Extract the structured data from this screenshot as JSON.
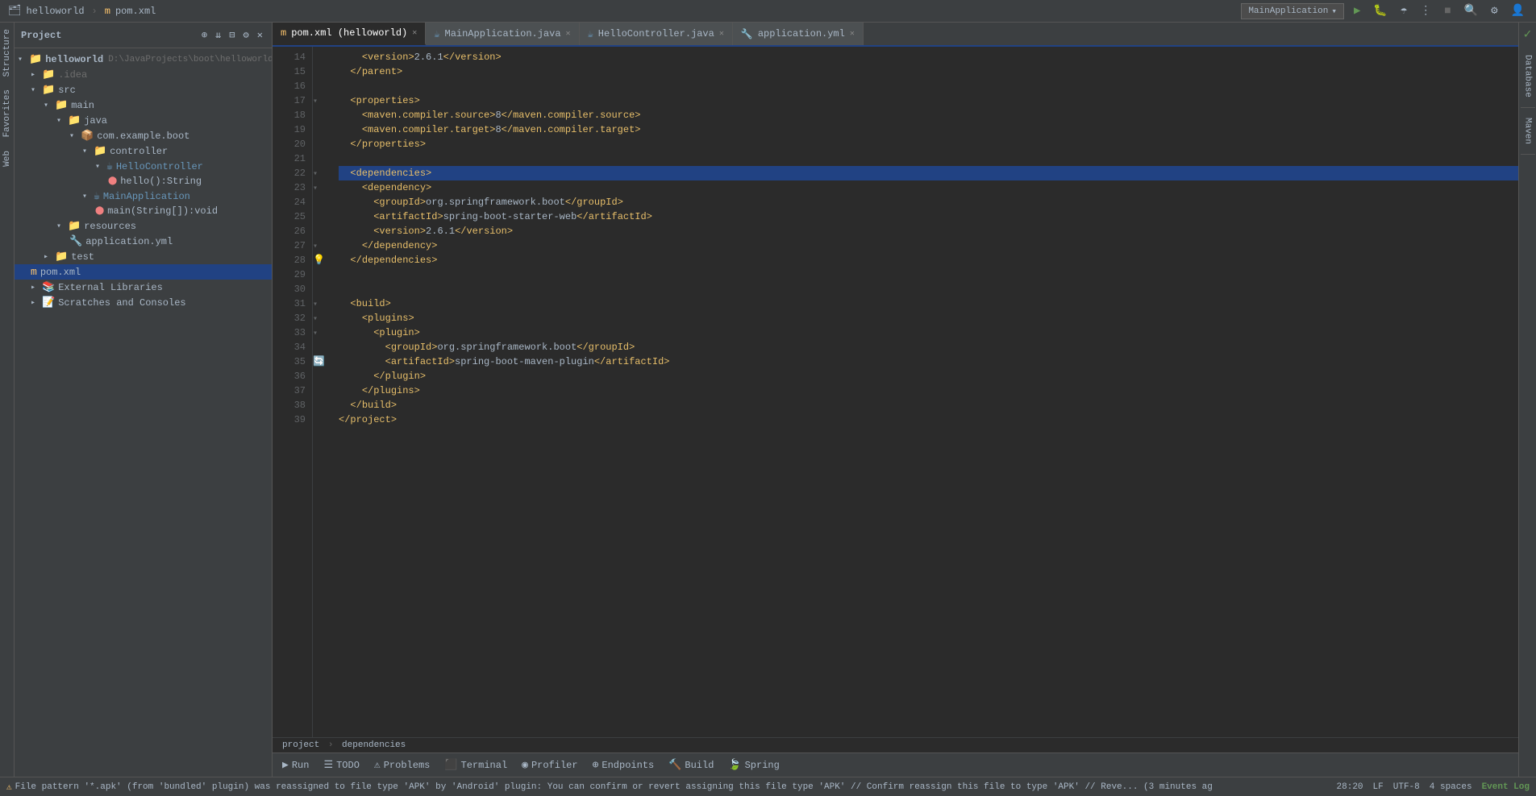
{
  "titleBar": {
    "project": "helloworld",
    "separator": "m",
    "file": "pom.xml",
    "runConfig": "MainApplication",
    "icons": [
      "user-icon",
      "arrow-icon",
      "search-icon",
      "settings-icon",
      "avatar-icon"
    ]
  },
  "toolbar": {
    "projectLabel": "Project",
    "buttons": [
      "add-content-icon",
      "collapse-all-icon",
      "filter-icon",
      "settings-icon",
      "close-icon"
    ]
  },
  "projectTree": {
    "root": "helloworld",
    "rootPath": "D:\\JavaProjects\\boot\\helloworld",
    "items": [
      {
        "id": "idea",
        "label": ".idea",
        "indent": 1,
        "type": "folder",
        "collapsed": true
      },
      {
        "id": "src",
        "label": "src",
        "indent": 1,
        "type": "folder",
        "collapsed": false
      },
      {
        "id": "main",
        "label": "main",
        "indent": 2,
        "type": "folder",
        "collapsed": false
      },
      {
        "id": "java",
        "label": "java",
        "indent": 3,
        "type": "folder",
        "collapsed": false
      },
      {
        "id": "com.example.boot",
        "label": "com.example.boot",
        "indent": 4,
        "type": "package",
        "collapsed": false
      },
      {
        "id": "controller",
        "label": "controller",
        "indent": 5,
        "type": "folder",
        "collapsed": false
      },
      {
        "id": "HelloController",
        "label": "HelloController",
        "indent": 6,
        "type": "class"
      },
      {
        "id": "hello",
        "label": "hello():String",
        "indent": 7,
        "type": "method"
      },
      {
        "id": "MainApplication",
        "label": "MainApplication",
        "indent": 5,
        "type": "class"
      },
      {
        "id": "main-method",
        "label": "main(String[]):void",
        "indent": 6,
        "type": "method"
      },
      {
        "id": "resources",
        "label": "resources",
        "indent": 3,
        "type": "folder",
        "collapsed": false
      },
      {
        "id": "application.yml",
        "label": "application.yml",
        "indent": 4,
        "type": "yaml"
      },
      {
        "id": "test",
        "label": "test",
        "indent": 2,
        "type": "folder",
        "collapsed": true
      },
      {
        "id": "pom.xml",
        "label": "pom.xml",
        "indent": 1,
        "type": "xml"
      },
      {
        "id": "external-libraries",
        "label": "External Libraries",
        "indent": 1,
        "type": "library",
        "collapsed": true
      },
      {
        "id": "scratches",
        "label": "Scratches and Consoles",
        "indent": 1,
        "type": "scratches",
        "collapsed": true
      }
    ]
  },
  "tabs": [
    {
      "id": "pom-xml",
      "label": "pom.xml (helloworld)",
      "icon": "xml-icon",
      "active": true,
      "closable": true
    },
    {
      "id": "main-app",
      "label": "MainApplication.java",
      "icon": "java-icon",
      "active": false,
      "closable": true
    },
    {
      "id": "hello-ctrl",
      "label": "HelloController.java",
      "icon": "java-icon",
      "active": false,
      "closable": true
    },
    {
      "id": "app-yml",
      "label": "application.yml",
      "icon": "yaml-icon",
      "active": false,
      "closable": true
    }
  ],
  "codeLines": [
    {
      "num": 14,
      "content": "    <version>2.6.1</version>",
      "type": "xml"
    },
    {
      "num": 15,
      "content": "  </parent>",
      "type": "xml"
    },
    {
      "num": 16,
      "content": "",
      "type": "empty"
    },
    {
      "num": 17,
      "content": "  <properties>",
      "type": "xml",
      "foldable": true
    },
    {
      "num": 18,
      "content": "    <maven.compiler.source>8</maven.compiler.source>",
      "type": "xml"
    },
    {
      "num": 19,
      "content": "    <maven.compiler.target>8</maven.compiler.target>",
      "type": "xml"
    },
    {
      "num": 20,
      "content": "  </properties>",
      "type": "xml"
    },
    {
      "num": 21,
      "content": "",
      "type": "empty"
    },
    {
      "num": 22,
      "content": "  <dependencies>",
      "type": "xml",
      "foldable": true,
      "highlighted": true
    },
    {
      "num": 23,
      "content": "    <dependency>",
      "type": "xml",
      "foldable": true,
      "gutter": "refresh"
    },
    {
      "num": 24,
      "content": "      <groupId>org.springframework.boot</groupId>",
      "type": "xml"
    },
    {
      "num": 25,
      "content": "      <artifactId>spring-boot-starter-web</artifactId>",
      "type": "xml"
    },
    {
      "num": 26,
      "content": "      <version>2.6.1</version>",
      "type": "xml"
    },
    {
      "num": 27,
      "content": "    </dependency>",
      "type": "xml",
      "foldable": true
    },
    {
      "num": 28,
      "content": "  </dependencies>",
      "type": "xml",
      "gutter": "bulb"
    },
    {
      "num": 29,
      "content": "",
      "type": "empty"
    },
    {
      "num": 30,
      "content": "",
      "type": "empty"
    },
    {
      "num": 31,
      "content": "  <build>",
      "type": "xml",
      "foldable": true
    },
    {
      "num": 32,
      "content": "    <plugins>",
      "type": "xml",
      "foldable": true
    },
    {
      "num": 33,
      "content": "      <plugin>",
      "type": "xml",
      "foldable": true
    },
    {
      "num": 34,
      "content": "        <groupId>org.springframework.boot</groupId>",
      "type": "xml"
    },
    {
      "num": 35,
      "content": "        <artifactId>spring-boot-maven-plugin</artifactId>",
      "type": "xml",
      "gutter": "refresh"
    },
    {
      "num": 36,
      "content": "      </plugin>",
      "type": "xml"
    },
    {
      "num": 37,
      "content": "    </plugins>",
      "type": "xml"
    },
    {
      "num": 38,
      "content": "  </build>",
      "type": "xml"
    },
    {
      "num": 39,
      "content": "</project>",
      "type": "xml"
    }
  ],
  "breadcrumb": {
    "parts": [
      "project",
      "dependencies"
    ]
  },
  "bottomToolbar": {
    "buttons": [
      {
        "id": "run",
        "label": "Run",
        "icon": "▶"
      },
      {
        "id": "todo",
        "label": "TODO",
        "icon": "☰"
      },
      {
        "id": "problems",
        "label": "Problems",
        "icon": "⚠"
      },
      {
        "id": "terminal",
        "label": "Terminal",
        "icon": "⬛"
      },
      {
        "id": "profiler",
        "label": "Profiler",
        "icon": "◉"
      },
      {
        "id": "endpoints",
        "label": "Endpoints",
        "icon": "⊕"
      },
      {
        "id": "build",
        "label": "Build",
        "icon": "🔨"
      },
      {
        "id": "spring",
        "label": "Spring",
        "icon": "🍃"
      }
    ]
  },
  "statusBar": {
    "message": "File pattern '*.apk' (from 'bundled' plugin) was reassigned to file type 'APK' by 'Android' plugin: You can confirm or revert assigning this file type 'APK' // Confirm reassign this file to type 'APK' // Reve... (3 minutes ag",
    "position": "28:20",
    "encoding": "LF  UTF-8",
    "spaces": "4 spaces",
    "eventLog": "Event Log"
  },
  "rightSidebar": {
    "tabs": [
      "Database",
      "Maven"
    ],
    "checkmark": "✓"
  },
  "leftSidebarTabs": [
    "Structure",
    "Favorites",
    "Web"
  ]
}
